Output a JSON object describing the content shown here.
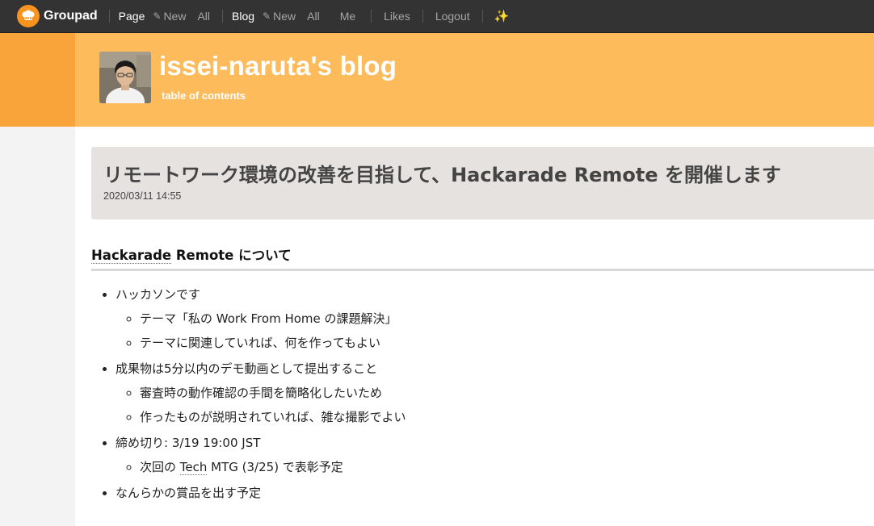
{
  "nav": {
    "brand": "Groupad",
    "page_label": "Page",
    "page_new": "New",
    "page_all": "All",
    "blog_label": "Blog",
    "blog_new": "New",
    "blog_all": "All",
    "blog_me": "Me",
    "likes": "Likes",
    "logout": "Logout",
    "sparkle_icon": "sparkle-icon"
  },
  "blog": {
    "title": "issei-naruta's blog",
    "toc": "table of contents"
  },
  "post": {
    "title": "リモートワーク環境の改善を目指して、Hackarade Remote を開催します",
    "date": "2020/03/11 14:55",
    "heading_link": "Hackarade",
    "heading_rest": " Remote について",
    "items": [
      {
        "text": "ハッカソンです",
        "children": [
          "テーマ「私の Work From Home の課題解決」",
          "テーマに関連していれば、何を作ってもよい"
        ]
      },
      {
        "text": "成果物は5分以内のデモ動画として提出すること",
        "children": [
          "審査時の動作確認の手間を簡略化したいため",
          "作ったものが説明されていれば、雑な撮影でよい"
        ]
      },
      {
        "text": "締め切り: 3/19 19:00 JST",
        "children_rich": {
          "prefix": "次回の ",
          "link": "Tech",
          "suffix": " MTG (3/25) で表彰予定"
        }
      },
      {
        "text": "なんらかの賞品を出す予定"
      }
    ]
  },
  "colors": {
    "topbar": "#333333",
    "header_orange": "#fdbb5c",
    "left_orange": "#f9a43a",
    "post_header_bg": "#e5e2df"
  }
}
